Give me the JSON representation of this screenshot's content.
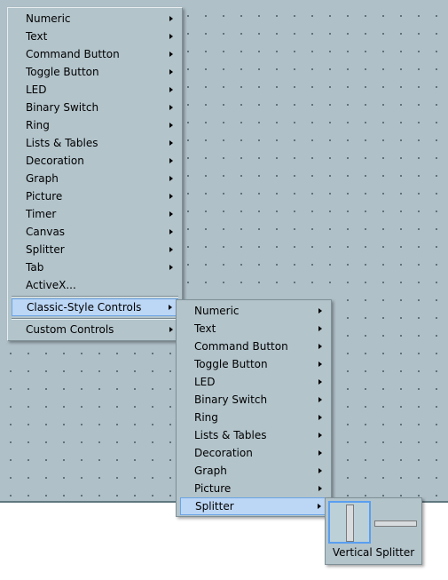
{
  "main_menu": {
    "items": [
      {
        "label": "Numeric"
      },
      {
        "label": "Text"
      },
      {
        "label": "Command Button"
      },
      {
        "label": "Toggle Button"
      },
      {
        "label": "LED"
      },
      {
        "label": "Binary Switch"
      },
      {
        "label": "Ring"
      },
      {
        "label": "Lists & Tables"
      },
      {
        "label": "Decoration"
      },
      {
        "label": "Graph"
      },
      {
        "label": "Picture"
      },
      {
        "label": "Timer"
      },
      {
        "label": "Canvas"
      },
      {
        "label": "Splitter"
      },
      {
        "label": "Tab"
      },
      {
        "label": "ActiveX..."
      }
    ],
    "classic_label": "Classic-Style Controls",
    "custom_label": "Custom Controls"
  },
  "classic_menu": {
    "items": [
      {
        "label": "Numeric"
      },
      {
        "label": "Text"
      },
      {
        "label": "Command Button"
      },
      {
        "label": "Toggle Button"
      },
      {
        "label": "LED"
      },
      {
        "label": "Binary Switch"
      },
      {
        "label": "Ring"
      },
      {
        "label": "Lists & Tables"
      },
      {
        "label": "Decoration"
      },
      {
        "label": "Graph"
      },
      {
        "label": "Picture"
      },
      {
        "label": "Splitter"
      }
    ]
  },
  "splitter_palette": {
    "label": "Vertical Splitter"
  },
  "colors": {
    "panel_bg": "#b0c0c8",
    "menu_bg": "#b3c4cb",
    "highlight_bg": "#bcd6f5",
    "highlight_border": "#6aa4e4"
  }
}
